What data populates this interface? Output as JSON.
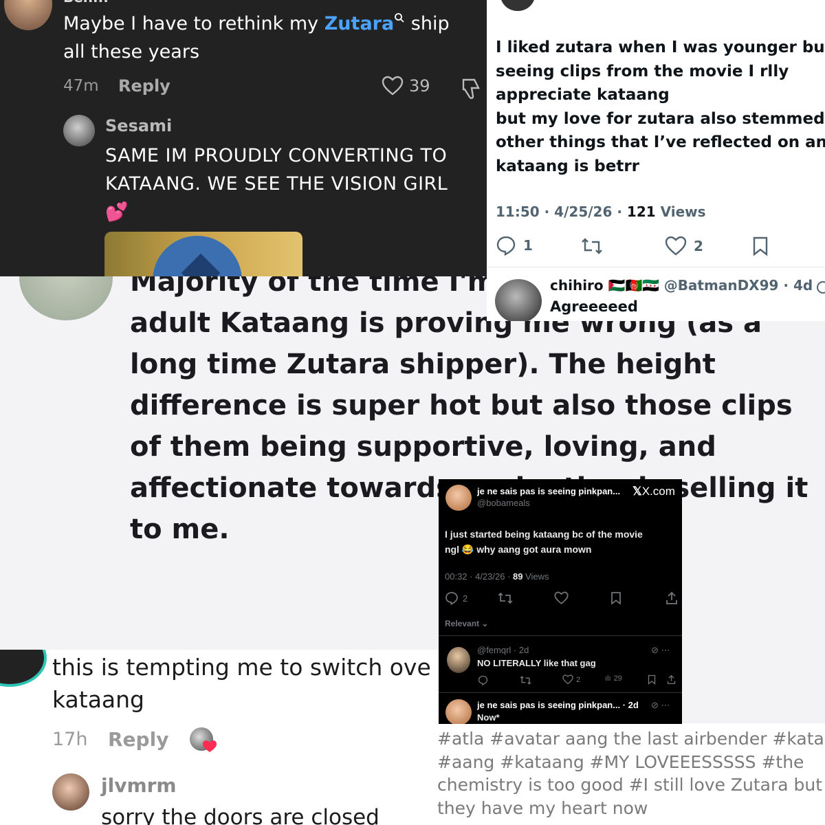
{
  "p1": {
    "user_partial": "Ben...",
    "comment_text_a": "Maybe I have to rethink my ",
    "comment_link": "Zutara",
    "comment_text_b": " ship",
    "comment_line2": "all these years",
    "time": "47m",
    "reply": "Reply",
    "likes": "39",
    "reply_user": "Sesami",
    "reply_line1": "SAME IM PROUDLY CONVERTING TO",
    "reply_line2": "KATAANG. WE SEE THE VISION GIRL",
    "reply_emoji": "💕",
    "colors": {
      "link": "#4aa3ff",
      "muted": "#9a9a9a",
      "bg": "#222222"
    }
  },
  "p2": {
    "line1": "I liked zutara when I was younger but",
    "line2": "seeing clips from the movie I rlly",
    "line3": "appreciate kataang",
    "line4": "but my love for zutara also stemmed fro",
    "line5": "other things that I’ve reflected on and y",
    "line6": "kataang is betrr",
    "time": "11:50 · 4/25/26 · ",
    "views_count": "121",
    "views_label": " Views",
    "replies": "1",
    "likes": "2",
    "reply_user": "chihiro 🇵🇸🇦🇫🇸🇾",
    "reply_handle": "@BatmanDX99 · 4d",
    "reply_text": "Agreeeeed"
  },
  "p3": {
    "line0": "Majority of the time I'm",
    "line1": "adult Kataang is proving me wrong (as a",
    "line2": "long time Zutara shipper). The height",
    "line3": "difference is super hot but also those clips",
    "line4": "of them being supportive, loving, and",
    "line5": "affectionate towards each other is selling it",
    "line6": "to me."
  },
  "p4": {
    "line1": "this is tempting me to switch ove",
    "line2": "kataang",
    "time": "17h",
    "reply": "Reply",
    "reply_user": "jlvmrm",
    "reply_text": "sorry the doors are closed"
  },
  "p5": {
    "line1": "#atla  #avatar aang the last airbender  #katar",
    "line2": "#aang  #kataang  #MY LOVEEESSSSS  #the",
    "line3": "chemistry is too good  #I still love Zutara but",
    "line4": "they have my heart now"
  },
  "p6": {
    "user": "je ne sais pas is seeing pinkpan...",
    "brand": "X.com",
    "handle": "@bobameals",
    "text1": "I just started being kataang bc of the movie",
    "text2": "ngl 😂 why aang got aura mown",
    "time": "00:32 · 4/23/26 · ",
    "views_count": "89",
    "views_label": " Views",
    "replies": "2",
    "sort": "Relevant",
    "r1_handle": "@femqrl · 2d",
    "r1_text": "NO LITERALLY like that gag",
    "r1_likes": "2",
    "r1_views": "29",
    "r2_user": "je ne sais pas is seeing pinkpan... · 2d",
    "r2_text": "Now*"
  }
}
